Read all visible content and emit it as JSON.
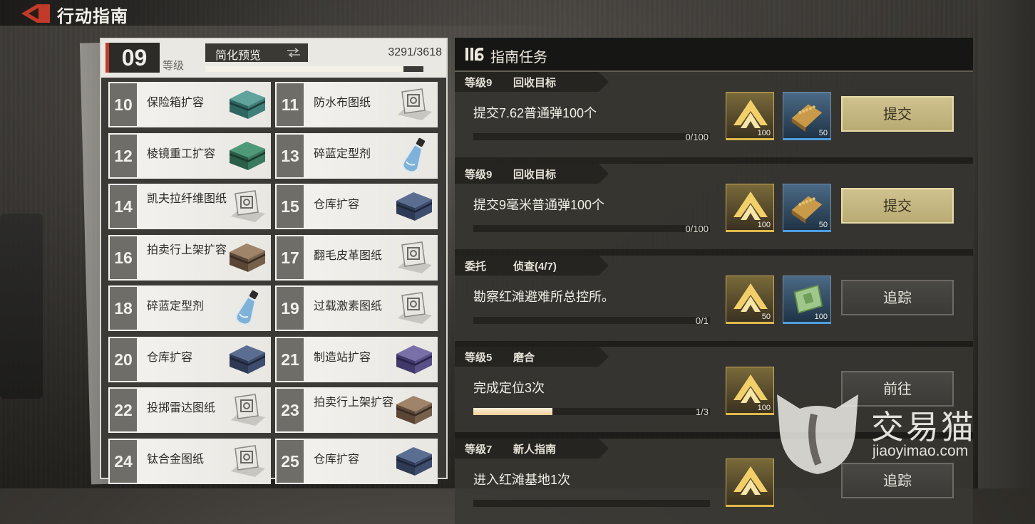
{
  "header": {
    "title": "行动指南"
  },
  "level": {
    "number": "09",
    "label": "等级",
    "preview_label": "简化预览",
    "xp_text": "3291/3618",
    "xp_progress": 0.91
  },
  "unlocks": [
    {
      "level": "10",
      "name": "保险箱扩容",
      "icon": "crate-teal-icon"
    },
    {
      "level": "11",
      "name": "防水布图纸",
      "icon": "blueprint-icon"
    },
    {
      "level": "12",
      "name": "棱镜重工扩容",
      "icon": "crate-green-icon"
    },
    {
      "level": "13",
      "name": "碎蓝定型剂",
      "icon": "flask-icon"
    },
    {
      "level": "14",
      "name": "凯夫拉纤维图纸",
      "icon": "blueprint-icon"
    },
    {
      "level": "15",
      "name": "仓库扩容",
      "icon": "crate-navy-icon"
    },
    {
      "level": "16",
      "name": "拍卖行上架扩容",
      "icon": "crate-brown-icon"
    },
    {
      "level": "17",
      "name": "翻毛皮革图纸",
      "icon": "blueprint-icon"
    },
    {
      "level": "18",
      "name": "碎蓝定型剂",
      "icon": "flask-icon"
    },
    {
      "level": "19",
      "name": "过载激素图纸",
      "icon": "blueprint-icon"
    },
    {
      "level": "20",
      "name": "仓库扩容",
      "icon": "crate-navy-icon"
    },
    {
      "level": "21",
      "name": "制造站扩容",
      "icon": "crate-purple-icon"
    },
    {
      "level": "22",
      "name": "投掷雷达图纸",
      "icon": "blueprint-icon"
    },
    {
      "level": "23",
      "name": "拍卖行上架扩容",
      "icon": "crate-brown-icon"
    },
    {
      "level": "24",
      "name": "钛合金图纸",
      "icon": "blueprint-icon"
    },
    {
      "level": "25",
      "name": "仓库扩容",
      "icon": "crate-navy-icon"
    }
  ],
  "tasks_panel": {
    "title": "指南任务"
  },
  "tasks": [
    {
      "type": "等级9",
      "category": "回收目标",
      "desc": "提交7.62普通弹100个",
      "progress_text": "0/100",
      "progress": 0,
      "rewards": [
        {
          "kind": "xp",
          "qty": "100"
        },
        {
          "kind": "item",
          "icon": "ammo-box-icon",
          "qty": "50"
        }
      ],
      "action": "提交",
      "action_style": "gold"
    },
    {
      "type": "等级9",
      "category": "回收目标",
      "desc": "提交9毫米普通弹100个",
      "progress_text": "0/100",
      "progress": 0,
      "rewards": [
        {
          "kind": "xp",
          "qty": "100"
        },
        {
          "kind": "item",
          "icon": "ammo-box-icon",
          "qty": "50"
        }
      ],
      "action": "提交",
      "action_style": "gold"
    },
    {
      "type": "委托",
      "category": "侦查(4/7)",
      "desc": "勘察红滩避难所总控所。",
      "progress_text": "0/1",
      "progress": 0,
      "rewards": [
        {
          "kind": "xp",
          "qty": "50"
        },
        {
          "kind": "item",
          "icon": "cash-icon",
          "qty": "100"
        }
      ],
      "action": "追踪",
      "action_style": "dark"
    },
    {
      "type": "等级5",
      "category": "磨合",
      "desc": "完成定位3次",
      "progress_text": "1/3",
      "progress": 0.333,
      "rewards": [
        {
          "kind": "xp",
          "qty": "100"
        }
      ],
      "action": "前往",
      "action_style": "dark"
    },
    {
      "type": "等级7",
      "category": "新人指南",
      "desc": "进入红滩基地1次",
      "progress_text": "",
      "progress": 0,
      "rewards": [
        {
          "kind": "xp",
          "qty": ""
        }
      ],
      "action": "追踪",
      "action_style": "dark"
    }
  ],
  "watermark": {
    "brand": "交易猫",
    "url": "jiaoyimao.com"
  },
  "colors": {
    "accent_red": "#c23a2a",
    "gold": "#cfc28f",
    "xp_gold": "#e0b94a",
    "item_blue": "#4f9fe0"
  }
}
